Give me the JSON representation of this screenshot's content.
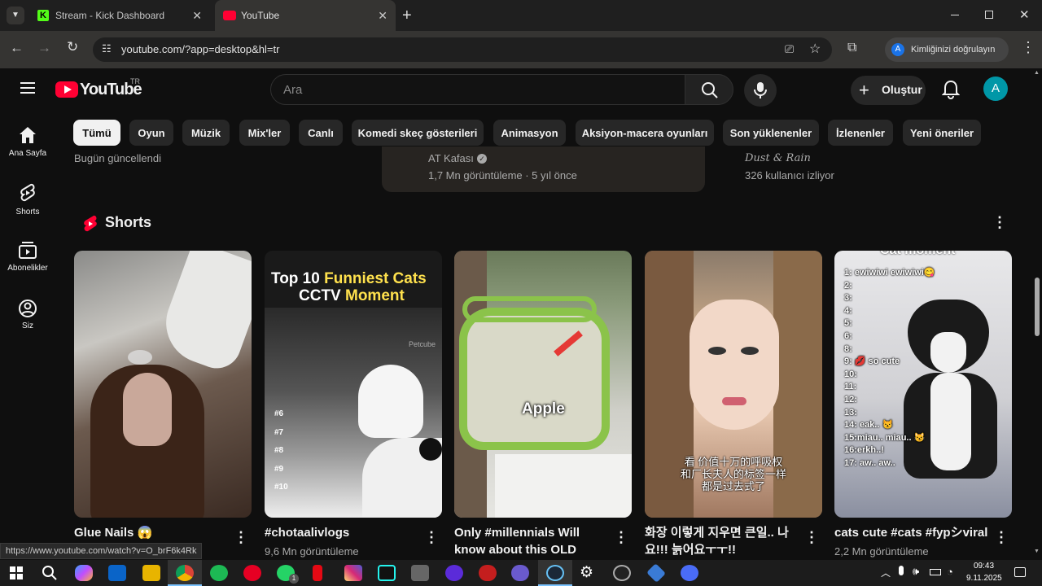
{
  "browser": {
    "tabs": [
      {
        "label": "Stream - Kick Dashboard"
      },
      {
        "label": "YouTube"
      }
    ],
    "url": "youtube.com/?app=desktop&hl=tr",
    "verify_label": "Kimliğinizi doğrulayın",
    "profile_letter": "A"
  },
  "header": {
    "logo_text": "YouTube",
    "country": "TR",
    "search_placeholder": "Ara",
    "create_label": "Oluştur",
    "avatar_letter": "A"
  },
  "sidebar": {
    "items": [
      {
        "label": "Ana Sayfa",
        "icon": "home-icon"
      },
      {
        "label": "Shorts",
        "icon": "shorts-icon"
      },
      {
        "label": "Abonelikler",
        "icon": "subscriptions-icon"
      },
      {
        "label": "Siz",
        "icon": "you-icon"
      }
    ]
  },
  "chips": [
    "Tümü",
    "Oyun",
    "Müzik",
    "Mix'ler",
    "Canlı",
    "Komedi skeç gösterileri",
    "Animasyon",
    "Aksiyon-macera oyunları",
    "Son yüklenenler",
    "İzlenenler",
    "Yeni öneriler"
  ],
  "top_row": {
    "left_meta": "Bugün güncellendi",
    "mid_channel": "AT Kafası",
    "mid_meta": "1,7 Mn görüntüleme · 5 yıl önce",
    "right_channel": "Dust & Rain",
    "right_meta": "326 kullanıcı izliyor"
  },
  "shorts": {
    "section_title": "Shorts",
    "items": [
      {
        "title": "Glue Nails 😱",
        "views": ""
      },
      {
        "title": "#chotaalivlogs",
        "views": "9,6 Mn görüntüleme",
        "thumb_line1a": "Top 10 ",
        "thumb_line1b": "Funniest Cats",
        "thumb_line2a": "CCTV ",
        "thumb_line2b": "Moment",
        "watermark": "Petcube",
        "ranks": [
          "#6",
          "#7",
          "#8",
          "#9",
          "#10"
        ]
      },
      {
        "title": "Only #millennials Will know about this OLD App...",
        "views": "",
        "thumb_text": "Apple"
      },
      {
        "title": "화장 이렇게 지우면 큰일.. 나요!!! 늙어요ㅜㅜ!!",
        "views": "",
        "thumb_text_line1": "看 价值十万的呼吸权",
        "thumb_text_line2": "和厂长夫人的标签一样",
        "thumb_text_line3": "都是过去式了"
      },
      {
        "title": "cats cute #cats #fypシviral",
        "views": "2,2 Mn görüntüleme",
        "thumb_header": "Cat moment",
        "list": [
          "1: ewiwiwi ewiwiwi😋",
          "2:",
          "3:",
          "4:",
          "5:",
          "6:",
          "8:",
          "9: 💋 so cute",
          "10:",
          "11:",
          "12:",
          "13:",
          "14: eak.. 😾",
          "15:miau.. miau.. 😼",
          "16:erkh..!",
          "17: aw.. aw.."
        ]
      }
    ]
  },
  "status_url": "https://www.youtube.com/watch?v=O_brF6k4Rk",
  "taskbar": {
    "time": "09:43",
    "date": "9.11.2025",
    "whatsapp_badge": "1"
  },
  "colors": {
    "yt_red": "#ff0033",
    "bg": "#0f0f0f",
    "chip_bg": "#272727",
    "avatar": "#0097a7"
  }
}
